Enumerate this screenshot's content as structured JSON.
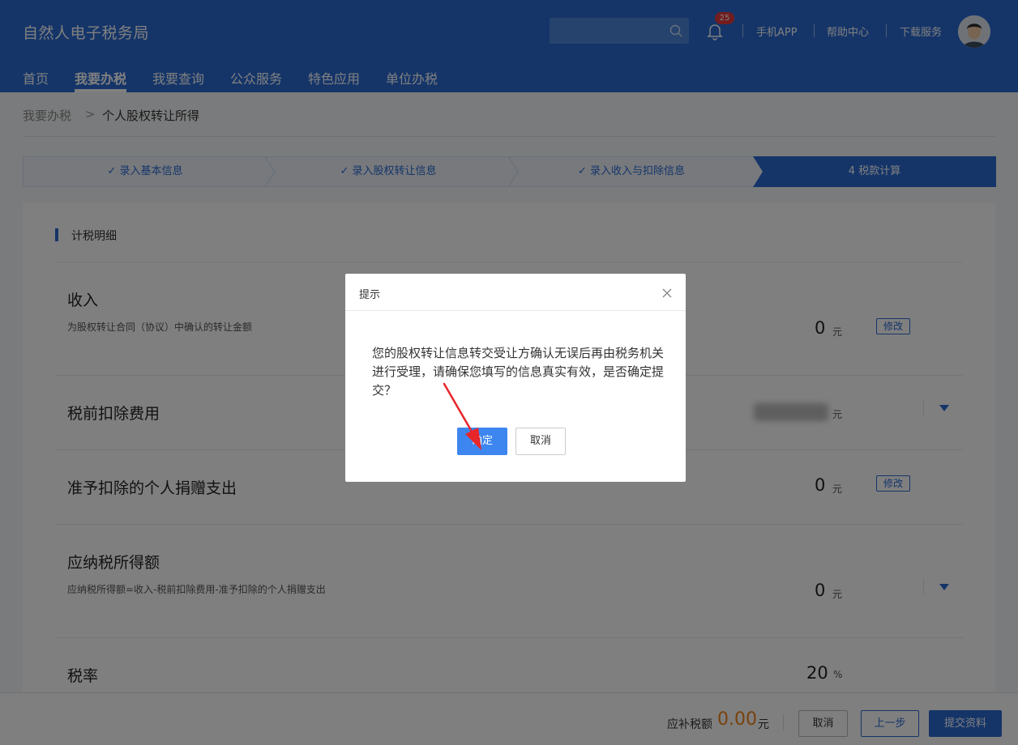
{
  "header": {
    "brand": "自然人电子税务局",
    "search_placeholder": "",
    "notification_count": "25",
    "links": [
      "手机APP",
      "帮助中心",
      "下载服务"
    ]
  },
  "nav": {
    "items": [
      "首页",
      "我要办税",
      "我要查询",
      "公众服务",
      "特色应用",
      "单位办税"
    ],
    "active": "我要办税"
  },
  "breadcrumb": {
    "parent": "我要办税",
    "separator": ">",
    "current": "个人股权转让所得"
  },
  "steps": [
    {
      "label": "✓ 录入基本信息",
      "status": "done"
    },
    {
      "label": "✓ 录入股权转让信息",
      "status": "done"
    },
    {
      "label": "✓ 录入收入与扣除信息",
      "status": "done"
    },
    {
      "label": "4 税款计算",
      "status": "active"
    }
  ],
  "section": {
    "title": "计税明细"
  },
  "rows": {
    "income": {
      "title": "收入",
      "subtitle": "为股权转让合同（协议）中确认的转让金额",
      "value": "0",
      "unit": "元",
      "action": "修改"
    },
    "pretax": {
      "title": "税前扣除费用",
      "unit": "元"
    },
    "donation": {
      "title": "准予扣除的个人捐赠支出",
      "value": "0",
      "unit": "元",
      "action": "修改"
    },
    "taxable": {
      "title": "应纳税所得额",
      "subtitle": "应纳税所得额=收入-税前扣除费用-准予扣除的个人捐赠支出",
      "value": "0",
      "unit": "元"
    },
    "rate": {
      "title": "税率",
      "value": "20",
      "unit": "%"
    }
  },
  "footer": {
    "due_label": "应补税额",
    "due_value": "0.00",
    "due_unit": "元",
    "cancel": "取消",
    "prev": "上一步",
    "submit": "提交资料"
  },
  "modal": {
    "title": "提示",
    "message": "您的股权转让信息转交受让方确认无误后再由税务机关进行受理，请确保您填写的信息真实有效，是否确定提交？",
    "ok": "确定",
    "cancel": "取消"
  },
  "colors": {
    "primary": "#2a6bd2",
    "accent": "#f08318",
    "ok_button": "#3d86f0",
    "annotation_arrow": "#e8262a"
  }
}
